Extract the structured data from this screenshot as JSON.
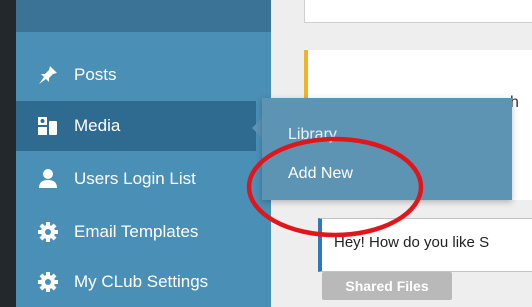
{
  "sidebar": {
    "items": [
      {
        "label": "Posts",
        "icon": "pin-icon"
      },
      {
        "label": "Media",
        "icon": "media-icon"
      },
      {
        "label": "Users Login List",
        "icon": "user-icon"
      },
      {
        "label": "Email Templates",
        "icon": "gear-icon"
      },
      {
        "label": "My CLub Settings",
        "icon": "gear-icon"
      }
    ]
  },
  "flyout": {
    "items": [
      {
        "label": "Library"
      },
      {
        "label": "Add New"
      }
    ]
  },
  "content": {
    "panel2_text": "h",
    "panel3_text": "Hey! How do you like S",
    "shared_files_button": "Shared Files"
  },
  "colors": {
    "sidebar": "#4a8fb6",
    "active": "#2f6a91",
    "flyout": "#5d94b4",
    "highlight_ring": "#e2161a"
  }
}
